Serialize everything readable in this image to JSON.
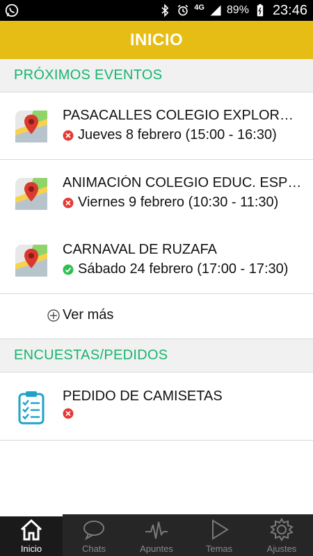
{
  "status_bar": {
    "network": "4G",
    "battery": "89%",
    "time": "23:46"
  },
  "app_bar": {
    "title": "INICIO"
  },
  "sections": {
    "events": {
      "header": "PRÓXIMOS EVENTOS",
      "items": [
        {
          "title": "PASACALLES COLEGIO EXPLORADORES",
          "date": "Jueves 8 febrero (15:00 - 16:30)",
          "status": "declined"
        },
        {
          "title": "ANIMACIÓN COLEGIO EDUC. ESPECIAL",
          "date": "Viernes 9 febrero (10:30 - 11:30)",
          "status": "declined"
        },
        {
          "title": "CARNAVAL DE RUZAFA",
          "date": "Sábado 24 febrero (17:00 - 17:30)",
          "status": "accepted"
        }
      ],
      "more_label": "Ver más"
    },
    "surveys": {
      "header": "ENCUESTAS/PEDIDOS",
      "items": [
        {
          "title": "PEDIDO DE CAMISETAS",
          "status": "declined"
        }
      ]
    }
  },
  "bottom_nav": {
    "items": [
      {
        "label": "Inicio",
        "icon": "home-icon",
        "active": true
      },
      {
        "label": "Chats",
        "icon": "chat-bubble-icon",
        "active": false
      },
      {
        "label": "Apuntes",
        "icon": "pulse-icon",
        "active": false
      },
      {
        "label": "Temas",
        "icon": "play-icon",
        "active": false
      },
      {
        "label": "Ajustes",
        "icon": "gear-icon",
        "active": false
      }
    ]
  },
  "colors": {
    "accent": "#e6bd14",
    "section_text": "#16b46e",
    "declined": "#e53935",
    "accepted": "#2fbf4f",
    "nav_bg": "#262626"
  }
}
